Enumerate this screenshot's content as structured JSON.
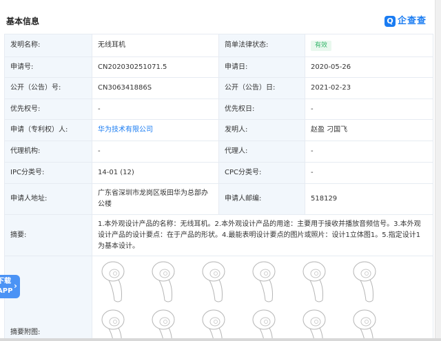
{
  "header": {
    "title": "基本信息",
    "logo_text": "企查查",
    "logo_mark": "Q"
  },
  "rows": {
    "r1": {
      "l1": "发明名称:",
      "v1": "无线耳机",
      "l2": "简单法律状态:",
      "v2": "有效"
    },
    "r2": {
      "l1": "申请号:",
      "v1": "CN202030251071.5",
      "l2": "申请日:",
      "v2": "2020-05-26"
    },
    "r3": {
      "l1": "公开（公告）号:",
      "v1": "CN306341886S",
      "l2": "公开（公告）日:",
      "v2": "2021-02-23"
    },
    "r4": {
      "l1": "优先权号:",
      "v1": "-",
      "l2": "优先权日:",
      "v2": "-"
    },
    "r5": {
      "l1": "申请（专利权）人:",
      "v1": "华为技术有限公司",
      "l2": "发明人:",
      "v2": "赵盈 刁国飞"
    },
    "r6": {
      "l1": "代理机构:",
      "v1": "-",
      "l2": "代理人:",
      "v2": "-"
    },
    "r7": {
      "l1": "IPC分类号:",
      "v1": "14-01 (12)",
      "l2": "CPC分类号:",
      "v2": "-"
    },
    "r8": {
      "l1": "申请人地址:",
      "v1": "广东省深圳市龙岗区坂田华为总部办公楼",
      "l2": "申请人邮编:",
      "v2": "518129"
    }
  },
  "abstract": {
    "label": "摘要:",
    "text": "1.本外观设计产品的名称：无线耳机。2.本外观设计产品的用途：主要用于接收并播放音频信号。3.本外观设计产品的设计要点：在于产品的形状。4.最能表明设计要点的图片或照片：设计1立体图1。5.指定设计1为基本设计。"
  },
  "figures": {
    "label": "摘要附图:",
    "items": [
      "earbud-1",
      "earbud-2",
      "earbud-3",
      "earbud-4",
      "earbud-5",
      "earbud-6"
    ]
  },
  "float_tab": {
    "line1": "下载",
    "line2": "APP"
  },
  "colors": {
    "accent": "#1a7cf2",
    "label_bg": "#f2f7fc",
    "border": "#e6ebf2",
    "status_green": "#35b56a"
  }
}
